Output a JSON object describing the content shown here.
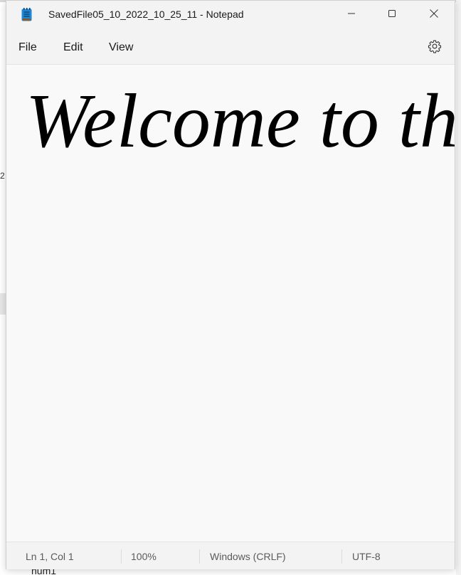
{
  "background": {
    "left_fragment": "2",
    "bottom_fragment": "num1"
  },
  "window": {
    "title": "SavedFile05_10_2022_10_25_11 - Notepad",
    "app_icon": "notepad-icon",
    "controls": {
      "minimize_icon": "minimize-icon",
      "maximize_icon": "maximize-icon",
      "close_icon": "close-icon"
    }
  },
  "menu": {
    "items": [
      {
        "label": "File"
      },
      {
        "label": "Edit"
      },
      {
        "label": "View"
      }
    ],
    "settings_icon": "gear-icon"
  },
  "editor": {
    "content": "Welcome to the"
  },
  "status": {
    "position": "Ln 1, Col 1",
    "zoom": "100%",
    "line_ending": "Windows (CRLF)",
    "encoding": "UTF-8"
  },
  "colors": {
    "titlebar": "#f3f3f3",
    "editor_bg": "#f9f9f9",
    "text": "#000000",
    "icon_blue": "#1e88d6"
  }
}
